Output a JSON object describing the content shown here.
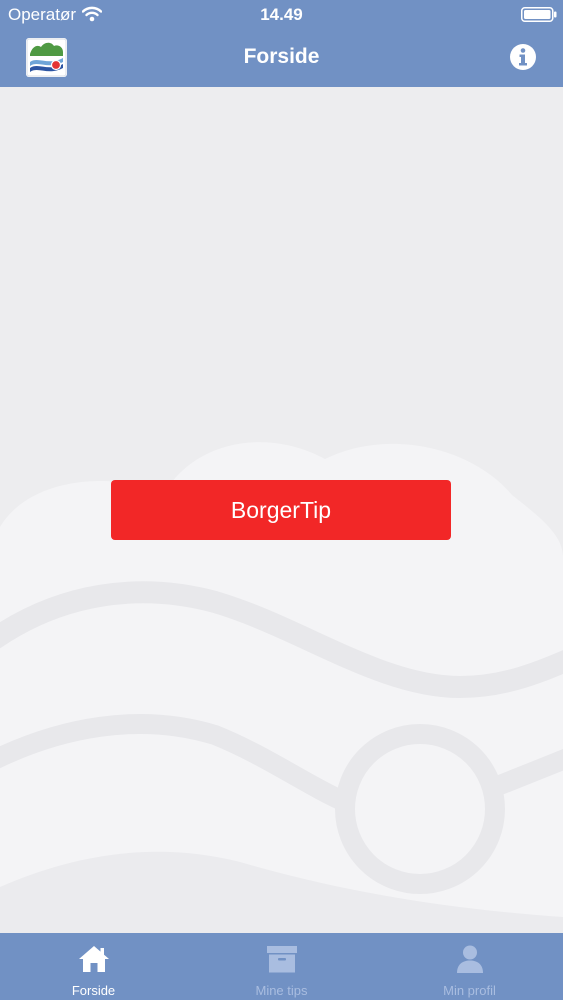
{
  "status_bar": {
    "carrier": "Operatør",
    "time": "14.49",
    "wifi_icon": "wifi-icon",
    "battery_icon": "battery-icon"
  },
  "nav_bar": {
    "title": "Forside",
    "logo_icon": "app-logo",
    "info_icon": "info-icon"
  },
  "main": {
    "cta_label": "BorgerTip"
  },
  "tab_bar": {
    "tabs": [
      {
        "label": "Forside",
        "icon": "home-icon",
        "active": true
      },
      {
        "label": "Mine tips",
        "icon": "archive-box-icon",
        "active": false
      },
      {
        "label": "Min profil",
        "icon": "person-icon",
        "active": false
      }
    ]
  },
  "colors": {
    "bar_background": "#7191c4",
    "content_background": "#ededef",
    "cta_background": "#f22727",
    "active_tab": "#ffffff",
    "inactive_tab": "#a9bde0"
  }
}
